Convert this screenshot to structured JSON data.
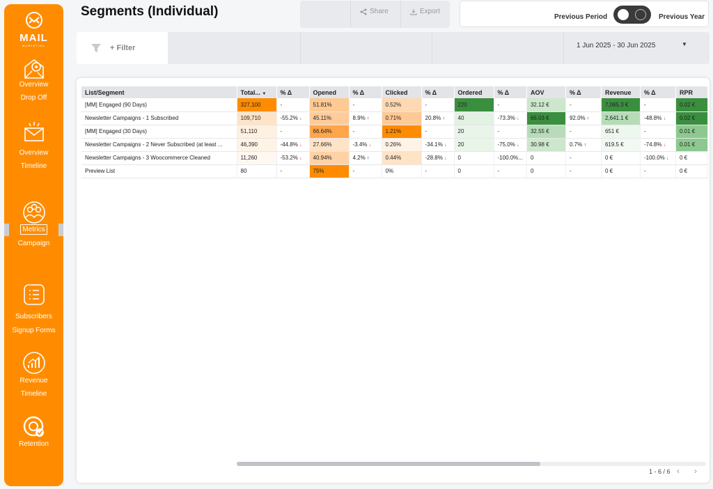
{
  "app": {
    "logo_text": "MAIL",
    "logo_sub": "MARKETING",
    "page_title": "Segments (Individual)"
  },
  "sidebar": {
    "items": [
      {
        "icon": "gear-envelope-icon",
        "line1": "Overview",
        "line2": "Drop Off"
      },
      {
        "icon": "envelope-burst-icon",
        "line1": "Overview",
        "line2": "Timeline"
      },
      {
        "icon": "users-circle-icon",
        "line1": "Metrics",
        "line2": "Campaign"
      },
      {
        "icon": "list-icon",
        "line1": "Subscribers",
        "line2": "Signup Forms"
      },
      {
        "icon": "growth-chart-icon",
        "line1": "Revenue",
        "line2": "Timeline"
      },
      {
        "icon": "retention-icon",
        "line1": "Retention",
        "line2": ""
      }
    ]
  },
  "toolbar": {
    "share_label": "Share",
    "export_label": "Export"
  },
  "period": {
    "left_label": "Previous Period",
    "right_label": "Previous Year"
  },
  "filter": {
    "add_label": "+ Filter",
    "date_range": "1 Jun 2025 - 30 Jun 2025"
  },
  "table": {
    "headers": [
      "List/Segment",
      "Total...",
      "% Δ",
      "Opened",
      "% Δ",
      "Clicked",
      "% Δ",
      "Ordered",
      "% Δ",
      "AOV",
      "% Δ",
      "Revenue",
      "% Δ",
      "RPR"
    ],
    "rows": [
      [
        "[MM] Engaged (90 Days)",
        "327,100",
        "-",
        "51.81%",
        "-",
        "0.52%",
        "-",
        "220",
        "-",
        "32.12 €",
        "-",
        "7,065.3 €",
        "-",
        "0.02 €"
      ],
      [
        "Newsletter Campaigns - 1 Subscribed",
        "109,710",
        "-55.2%",
        "45.11%",
        "8.9%",
        "0.71%",
        "20.8%",
        "40",
        "-73.3%",
        "66.03 €",
        "92.0%",
        "2,641.1 €",
        "-48.8%",
        "0.02 €"
      ],
      [
        "[MM] Engaged (30 Days)",
        "51,110",
        "-",
        "66.64%",
        "-",
        "1.21%",
        "-",
        "20",
        "-",
        "32.55 €",
        "-",
        "651 €",
        "-",
        "0.01 €"
      ],
      [
        "Newsletter Campaigns - 2 Never Subscribed (at least ...",
        "46,390",
        "-44.8%",
        "27.66%",
        "-3.4%",
        "0.26%",
        "-34.1%",
        "20",
        "-75.0%",
        "30.98 €",
        "0.7%",
        "619.5 €",
        "-74.8%",
        "0.01 €"
      ],
      [
        "Newsletter Campaigns - 3 Woocommerce Cleaned",
        "11,260",
        "-53.2%",
        "40.94%",
        "4.2%",
        "0.44%",
        "-28.8%",
        "0",
        "-100.0%...",
        "0",
        "-",
        "0 €",
        "-100.0%",
        "0 €"
      ],
      [
        "Preview List",
        "80",
        "-",
        "75%",
        "-",
        "0%",
        "-",
        "0",
        "-",
        "0",
        "-",
        "0 €",
        "-",
        "0 €"
      ]
    ],
    "pagination": "1 - 6 / 6"
  },
  "colors": {
    "accent": "#ff8c00",
    "sidebar_bg": "#ff8c00",
    "orange_heat": [
      "#ff8c00",
      "#ffa54a",
      "#ffc994",
      "#ffe3c6",
      "#fff3e6"
    ],
    "green_heat": [
      "#3a8f3f",
      "#8dc98f",
      "#cde7cd",
      "#e9f4e9"
    ]
  }
}
